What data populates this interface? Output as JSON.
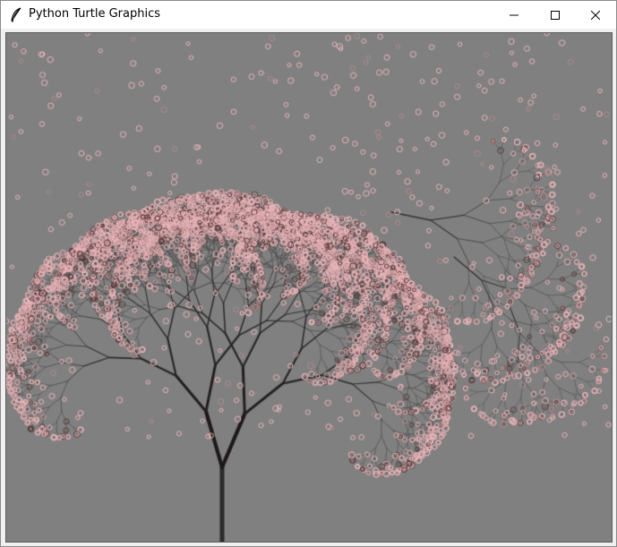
{
  "window": {
    "title": "Python Turtle Graphics",
    "app_icon": "feather-icon",
    "controls": {
      "minimize": "minimize-icon",
      "maximize": "maximize-icon",
      "close": "close-icon"
    }
  },
  "canvas": {
    "background": "#808080",
    "trunk_color": "#2b2b2b",
    "blossom_color": "#e8b4b8",
    "blossom_dark": "#5a3a3a",
    "drawing": "recursive tree with pink blossoms"
  }
}
